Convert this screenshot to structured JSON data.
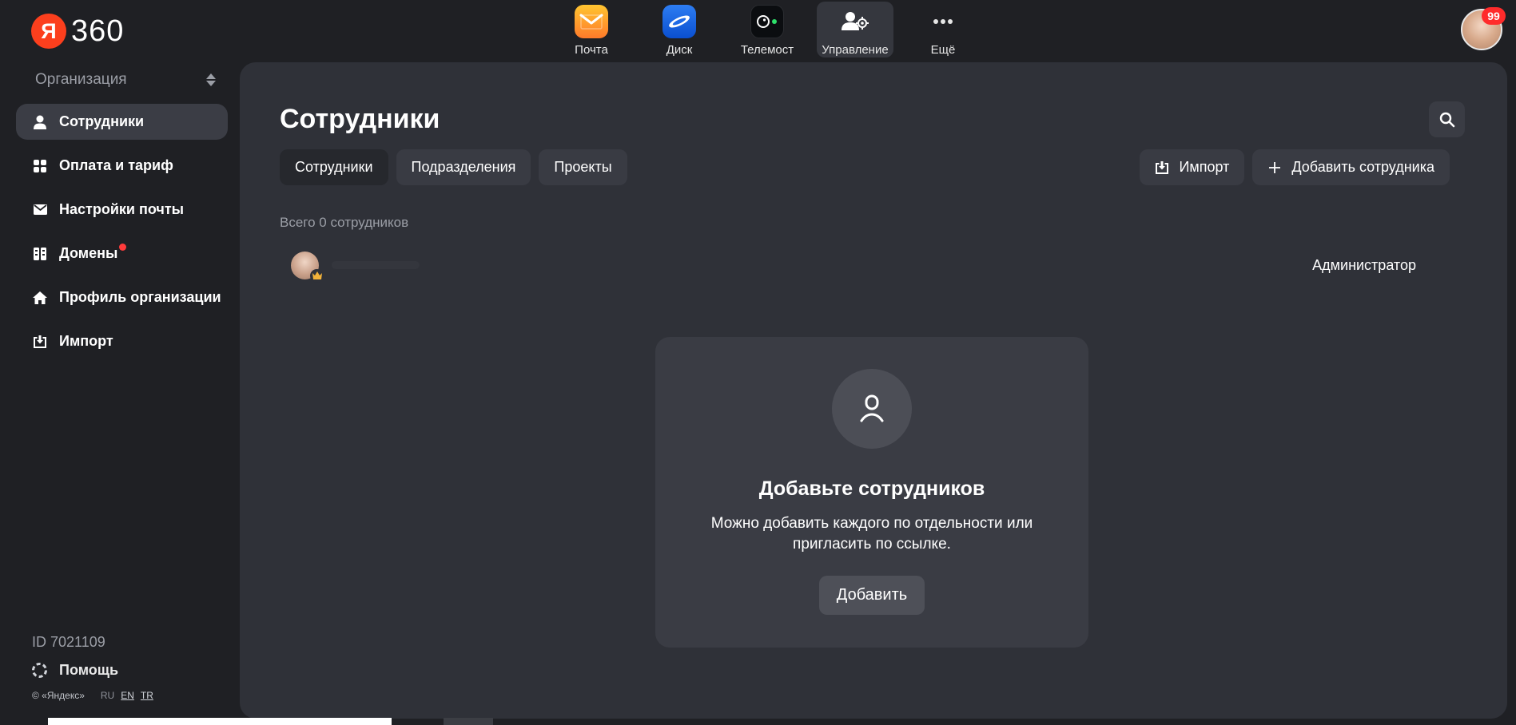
{
  "app": {
    "logo_letter": "Я",
    "logo_number": "360",
    "notification_count": "99"
  },
  "services": [
    {
      "label": "Почта",
      "icon": "mail-icon"
    },
    {
      "label": "Диск",
      "icon": "disk-icon"
    },
    {
      "label": "Телемост",
      "icon": "telemost-icon"
    },
    {
      "label": "Управление",
      "icon": "admin-icon",
      "active": true
    },
    {
      "label": "Ещё",
      "icon": "more-icon"
    }
  ],
  "sidebar": {
    "org_label": "Организация",
    "items": [
      {
        "label": "Сотрудники",
        "icon": "person-icon",
        "active": true
      },
      {
        "label": "Оплата и тариф",
        "icon": "grid-icon"
      },
      {
        "label": "Настройки почты",
        "icon": "envelope-icon"
      },
      {
        "label": "Домены",
        "icon": "domains-icon",
        "has_alert": true
      },
      {
        "label": "Профиль организации",
        "icon": "home-icon"
      },
      {
        "label": "Импорт",
        "icon": "import-icon"
      }
    ],
    "org_id": "ID 7021109",
    "help_label": "Помощь",
    "copyright": "© «Яндекс»",
    "languages": [
      "RU",
      "EN",
      "TR"
    ]
  },
  "main": {
    "title": "Сотрудники",
    "tabs": [
      {
        "label": "Сотрудники",
        "active": true
      },
      {
        "label": "Подразделения"
      },
      {
        "label": "Проекты"
      }
    ],
    "import_label": "Импорт",
    "add_employee_label": "Добавить сотрудника",
    "count_text": "Всего 0 сотрудников",
    "employee_role": "Администратор",
    "empty": {
      "title": "Добавьте сотрудников",
      "text": "Можно добавить каждого по отдельности или пригласить по ссылке.",
      "button": "Добавить"
    }
  },
  "colors": {
    "background": "#1f2024",
    "panel": "#2f3138",
    "button": "#393b43",
    "accent_red": "#fc3f1d",
    "alert_dot": "#ff3b3b"
  }
}
